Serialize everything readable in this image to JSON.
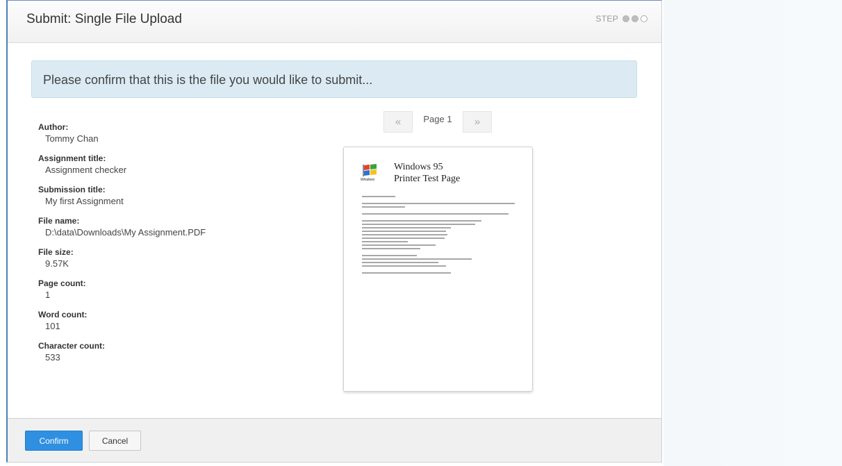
{
  "dialog": {
    "title": "Submit: Single File Upload",
    "step_label": "STEP",
    "steps_completed": 2,
    "steps_total": 3
  },
  "banner": {
    "text": "Please confirm that this is the file you would like to submit..."
  },
  "metadata": [
    {
      "label": "Author:",
      "value": "Tommy Chan"
    },
    {
      "label": "Assignment title:",
      "value": "Assignment checker"
    },
    {
      "label": "Submission title:",
      "value": "My first Assignment"
    },
    {
      "label": "File name:",
      "value": "D:\\data\\Downloads\\My Assignment.PDF"
    },
    {
      "label": "File size:",
      "value": "9.57K"
    },
    {
      "label": "Page count:",
      "value": "1"
    },
    {
      "label": "Word count:",
      "value": "101"
    },
    {
      "label": "Character count:",
      "value": "533"
    }
  ],
  "pager": {
    "prev_symbol": "«",
    "page_label": "Page 1",
    "next_symbol": "»"
  },
  "preview": {
    "logo_caption": "Windows",
    "title_line1": "Windows 95",
    "title_line2": "Printer Test Page"
  },
  "footer": {
    "confirm_label": "Confirm",
    "cancel_label": "Cancel"
  },
  "colors": {
    "accent": "#2f8fe0",
    "banner_bg": "#dcebf3"
  }
}
